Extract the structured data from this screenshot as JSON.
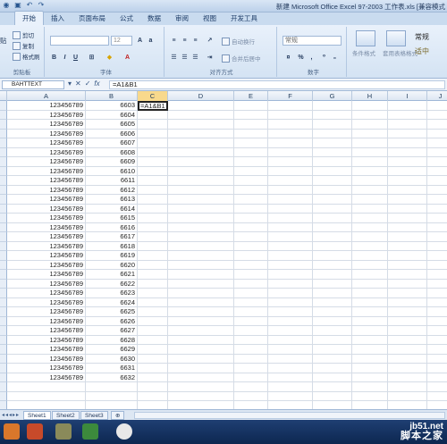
{
  "window": {
    "title": "新建 Microsoft Office Excel 97-2003 工作表.xls  [兼容模式"
  },
  "ribbon": {
    "tabs": [
      "开始",
      "插入",
      "页面布局",
      "公式",
      "数据",
      "审阅",
      "视图",
      "开发工具"
    ],
    "active_tab": "开始",
    "clipboard": {
      "cut": "剪切",
      "copy": "复制",
      "format_painter": "格式刷",
      "paste_label": "贴",
      "group": "剪贴板"
    },
    "font": {
      "size": "12",
      "group": "字体"
    },
    "alignment": {
      "wrap_text": "自动换行",
      "merge_center": "合并后居中",
      "group": "对齐方式"
    },
    "number": {
      "format": "常规",
      "percent": "%",
      "comma": ",",
      "group": "数字"
    },
    "styles": {
      "conditional": "条件格式",
      "table": "套用表格格式",
      "normal": "常规",
      "good": "适中"
    }
  },
  "formula_bar": {
    "name_box": "BAHTTEXT",
    "fx": "fx",
    "formula": "=A1&B1"
  },
  "columns": [
    "A",
    "B",
    "C",
    "D",
    "E",
    "F",
    "G",
    "H",
    "I",
    "J"
  ],
  "selected_column": "C",
  "rows": [
    {
      "a": "123456789",
      "b": "6603",
      "c": "=A1&B1"
    },
    {
      "a": "123456789",
      "b": "6604",
      "c": ""
    },
    {
      "a": "123456789",
      "b": "6605",
      "c": ""
    },
    {
      "a": "123456789",
      "b": "6606",
      "c": ""
    },
    {
      "a": "123456789",
      "b": "6607",
      "c": ""
    },
    {
      "a": "123456789",
      "b": "6608",
      "c": ""
    },
    {
      "a": "123456789",
      "b": "6609",
      "c": ""
    },
    {
      "a": "123456789",
      "b": "6610",
      "c": ""
    },
    {
      "a": "123456789",
      "b": "6611",
      "c": ""
    },
    {
      "a": "123456789",
      "b": "6612",
      "c": ""
    },
    {
      "a": "123456789",
      "b": "6613",
      "c": ""
    },
    {
      "a": "123456789",
      "b": "6614",
      "c": ""
    },
    {
      "a": "123456789",
      "b": "6615",
      "c": ""
    },
    {
      "a": "123456789",
      "b": "6616",
      "c": ""
    },
    {
      "a": "123456789",
      "b": "6617",
      "c": ""
    },
    {
      "a": "123456789",
      "b": "6618",
      "c": ""
    },
    {
      "a": "123456789",
      "b": "6619",
      "c": ""
    },
    {
      "a": "123456789",
      "b": "6620",
      "c": ""
    },
    {
      "a": "123456789",
      "b": "6621",
      "c": ""
    },
    {
      "a": "123456789",
      "b": "6622",
      "c": ""
    },
    {
      "a": "123456789",
      "b": "6623",
      "c": ""
    },
    {
      "a": "123456789",
      "b": "6624",
      "c": ""
    },
    {
      "a": "123456789",
      "b": "6625",
      "c": ""
    },
    {
      "a": "123456789",
      "b": "6626",
      "c": ""
    },
    {
      "a": "123456789",
      "b": "6627",
      "c": ""
    },
    {
      "a": "123456789",
      "b": "6628",
      "c": ""
    },
    {
      "a": "123456789",
      "b": "6629",
      "c": ""
    },
    {
      "a": "123456789",
      "b": "6630",
      "c": ""
    },
    {
      "a": "123456789",
      "b": "6631",
      "c": ""
    },
    {
      "a": "123456789",
      "b": "6632",
      "c": ""
    }
  ],
  "sheets": [
    "Sheet1",
    "Sheet2",
    "Sheet3"
  ],
  "active_sheet": "Sheet1",
  "watermark": {
    "url": "jb51.net",
    "brand": "脚本之家"
  },
  "colors": {
    "ribbon": "#d4e3f3",
    "selected_header": "#f8d98c",
    "taskbar": "#1f3f73"
  }
}
